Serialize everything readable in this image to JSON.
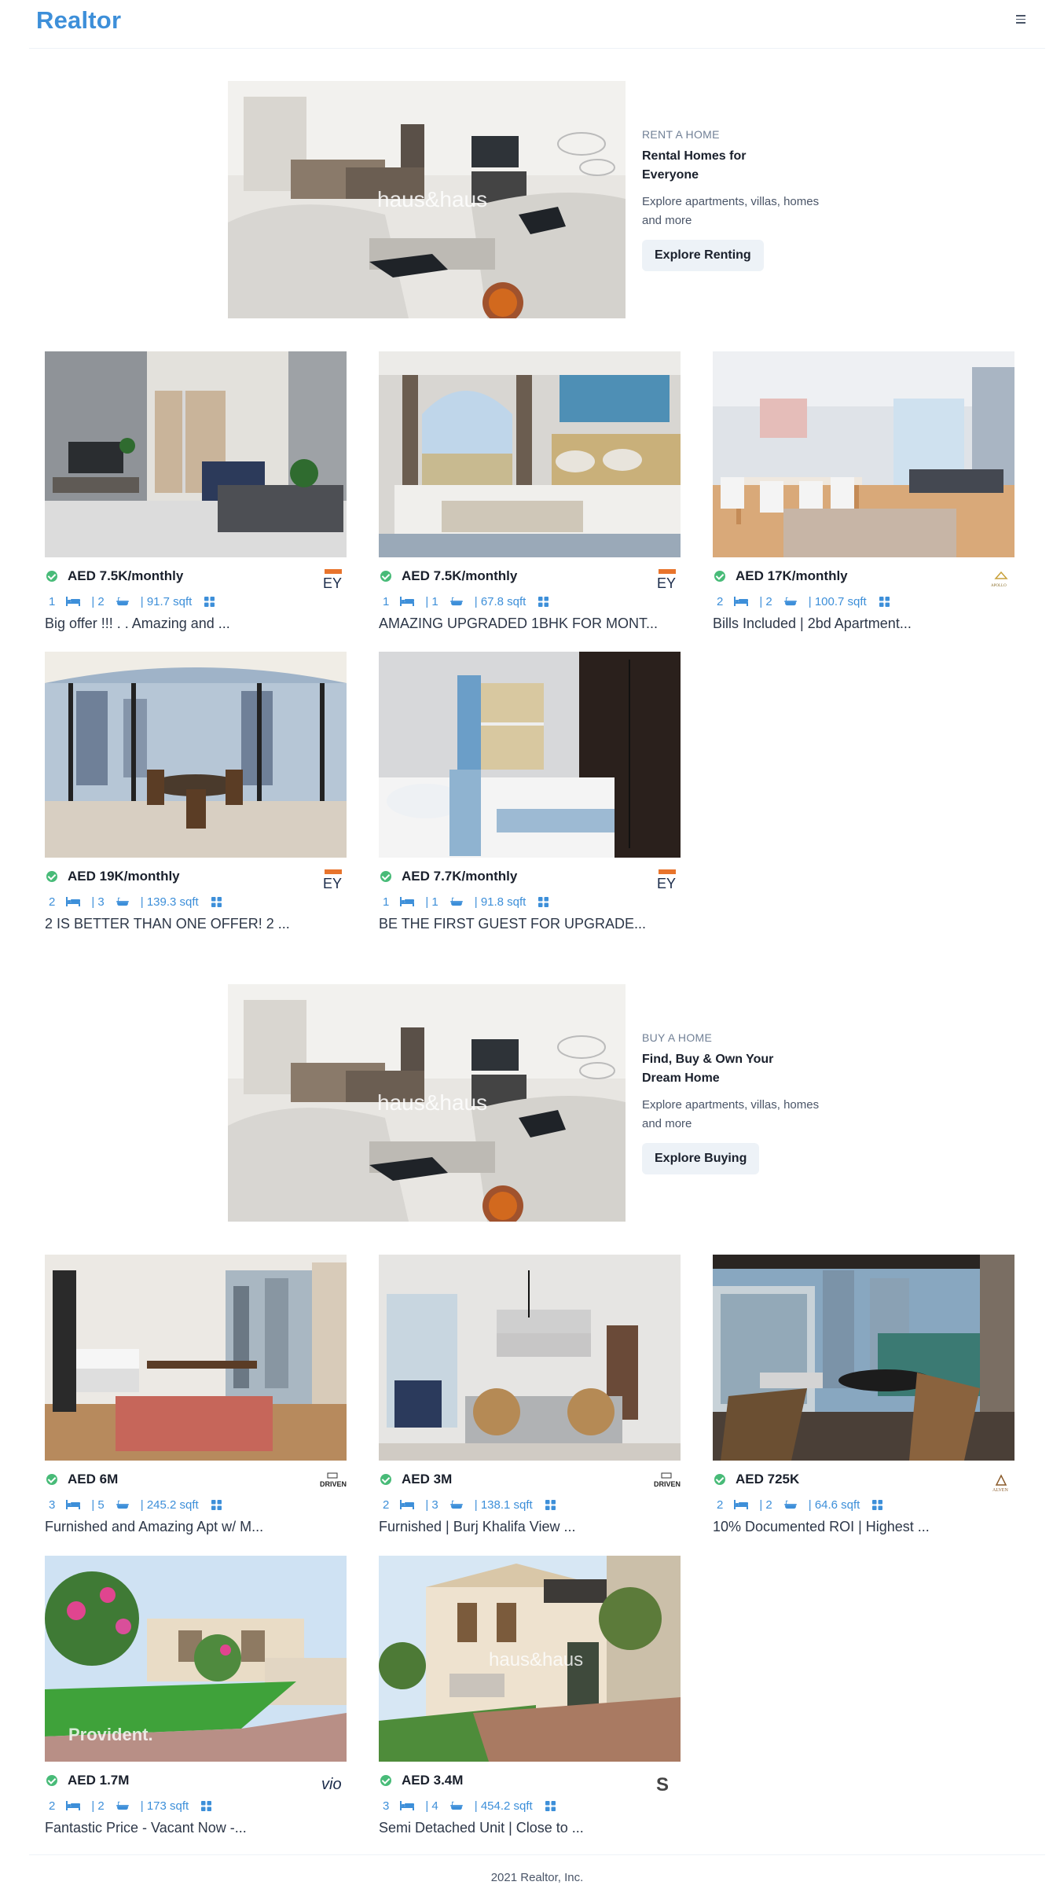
{
  "brand": "Realtor",
  "menu_icon": "hamburger-menu-icon",
  "rent_banner": {
    "purpose": "RENT A HOME",
    "title1": "Rental Homes for",
    "title2": "Everyone",
    "desc1": "Explore apartments, villas, homes",
    "desc2": "and more",
    "button": "Explore Renting",
    "watermark": "haus&haus"
  },
  "buy_banner": {
    "purpose": "BUY A HOME",
    "title1": "Find, Buy & Own Your",
    "title2": "Dream Home",
    "desc1": "Explore apartments, villas, homes",
    "desc2": "and more",
    "button": "Explore Buying",
    "watermark": "haus&haus"
  },
  "rent_properties": [
    {
      "price": "AED 7.5K/monthly",
      "rooms": "1",
      "baths": "| 2",
      "area": "| 91.7 sqft",
      "title": "Big offer !!! . . Amazing and ...",
      "agency": "EY"
    },
    {
      "price": "AED 7.5K/monthly",
      "rooms": "1",
      "baths": "| 1",
      "area": "| 67.8 sqft",
      "title": "AMAZING UPGRADED 1BHK FOR MONT...",
      "agency": "EY"
    },
    {
      "price": "AED 17K/monthly",
      "rooms": "2",
      "baths": "| 2",
      "area": "| 100.7 sqft",
      "title": "Bills Included | 2bd Apartment...",
      "agency": "APOLLO"
    },
    {
      "price": "AED 19K/monthly",
      "rooms": "2",
      "baths": "| 3",
      "area": "| 139.3 sqft",
      "title": "2 IS BETTER THAN ONE OFFER! 2 ...",
      "agency": "EY"
    },
    {
      "price": "AED 7.7K/monthly",
      "rooms": "1",
      "baths": "| 1",
      "area": "| 91.8 sqft",
      "title": "BE THE FIRST GUEST FOR UPGRADE...",
      "agency": "EY"
    }
  ],
  "buy_properties": [
    {
      "price": "AED 6M",
      "rooms": "3",
      "baths": "| 5",
      "area": "| 245.2 sqft",
      "title": "Furnished and Amazing Apt w/ M...",
      "agency": "DRIVEN"
    },
    {
      "price": "AED 3M",
      "rooms": "2",
      "baths": "| 3",
      "area": "| 138.1 sqft",
      "title": "Furnished | Burj Khalifa View ...",
      "agency": "DRIVEN"
    },
    {
      "price": "AED 725K",
      "rooms": "2",
      "baths": "| 2",
      "area": "| 64.6 sqft",
      "title": "10% Documented ROI | Highest ...",
      "agency": "ALVEN"
    },
    {
      "price": "AED 1.7M",
      "rooms": "2",
      "baths": "| 2",
      "area": "| 173 sqft",
      "title": "Fantastic Price - Vacant Now -...",
      "agency": "vio",
      "watermark": "Provident."
    },
    {
      "price": "AED 3.4M",
      "rooms": "3",
      "baths": "| 4",
      "area": "| 454.2 sqft",
      "title": "Semi Detached Unit | Close to ...",
      "agency": "S",
      "watermark": "haus&haus"
    }
  ],
  "footer": "2021 Realtor, Inc.",
  "colors": {
    "accent": "#3d8fd9",
    "verified": "#48bb78",
    "button_bg": "#edf2f7"
  }
}
